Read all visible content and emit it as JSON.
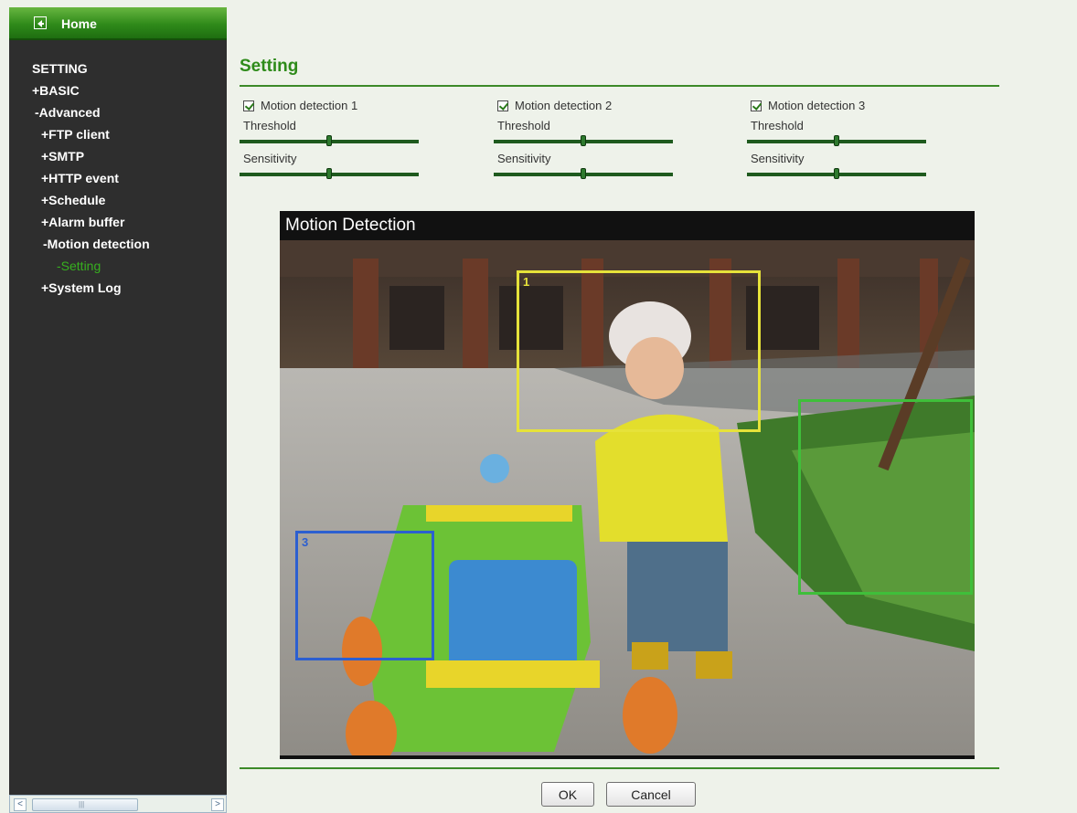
{
  "sidebar": {
    "home_label": "Home",
    "items": [
      {
        "label": "SETTING"
      },
      {
        "label": "+BASIC"
      },
      {
        "label": "-Advanced"
      },
      {
        "label": "+FTP client"
      },
      {
        "label": "+SMTP"
      },
      {
        "label": "+HTTP event"
      },
      {
        "label": "+Schedule"
      },
      {
        "label": "+Alarm buffer"
      },
      {
        "label": "-Motion detection"
      },
      {
        "label": "-Setting"
      },
      {
        "label": "+System Log"
      }
    ],
    "scroll_left": "<",
    "scroll_right": ">",
    "scroll_grip": "|||"
  },
  "main": {
    "title": "Setting",
    "detections": [
      {
        "label": "Motion detection 1",
        "checked": true,
        "threshold_label": "Threshold",
        "threshold_value": 0.5,
        "sensitivity_label": "Sensitivity",
        "sensitivity_value": 0.5
      },
      {
        "label": "Motion detection 2",
        "checked": true,
        "threshold_label": "Threshold",
        "threshold_value": 0.5,
        "sensitivity_label": "Sensitivity",
        "sensitivity_value": 0.5
      },
      {
        "label": "Motion detection 3",
        "checked": true,
        "threshold_label": "Threshold",
        "threshold_value": 0.5,
        "sensitivity_label": "Sensitivity",
        "sensitivity_value": 0.5
      }
    ],
    "video": {
      "title": "Motion Detection",
      "zones": [
        {
          "label": "1",
          "color": "#e6e23a"
        },
        {
          "label": "",
          "color": "#3fbf3a"
        },
        {
          "label": "3",
          "color": "#2c5fd0"
        }
      ]
    },
    "buttons": {
      "ok": "OK",
      "cancel": "Cancel"
    }
  },
  "colors": {
    "accent": "#2e8b1a",
    "sidebar_bg": "#2e2e2e",
    "active_item": "#37b01f"
  }
}
